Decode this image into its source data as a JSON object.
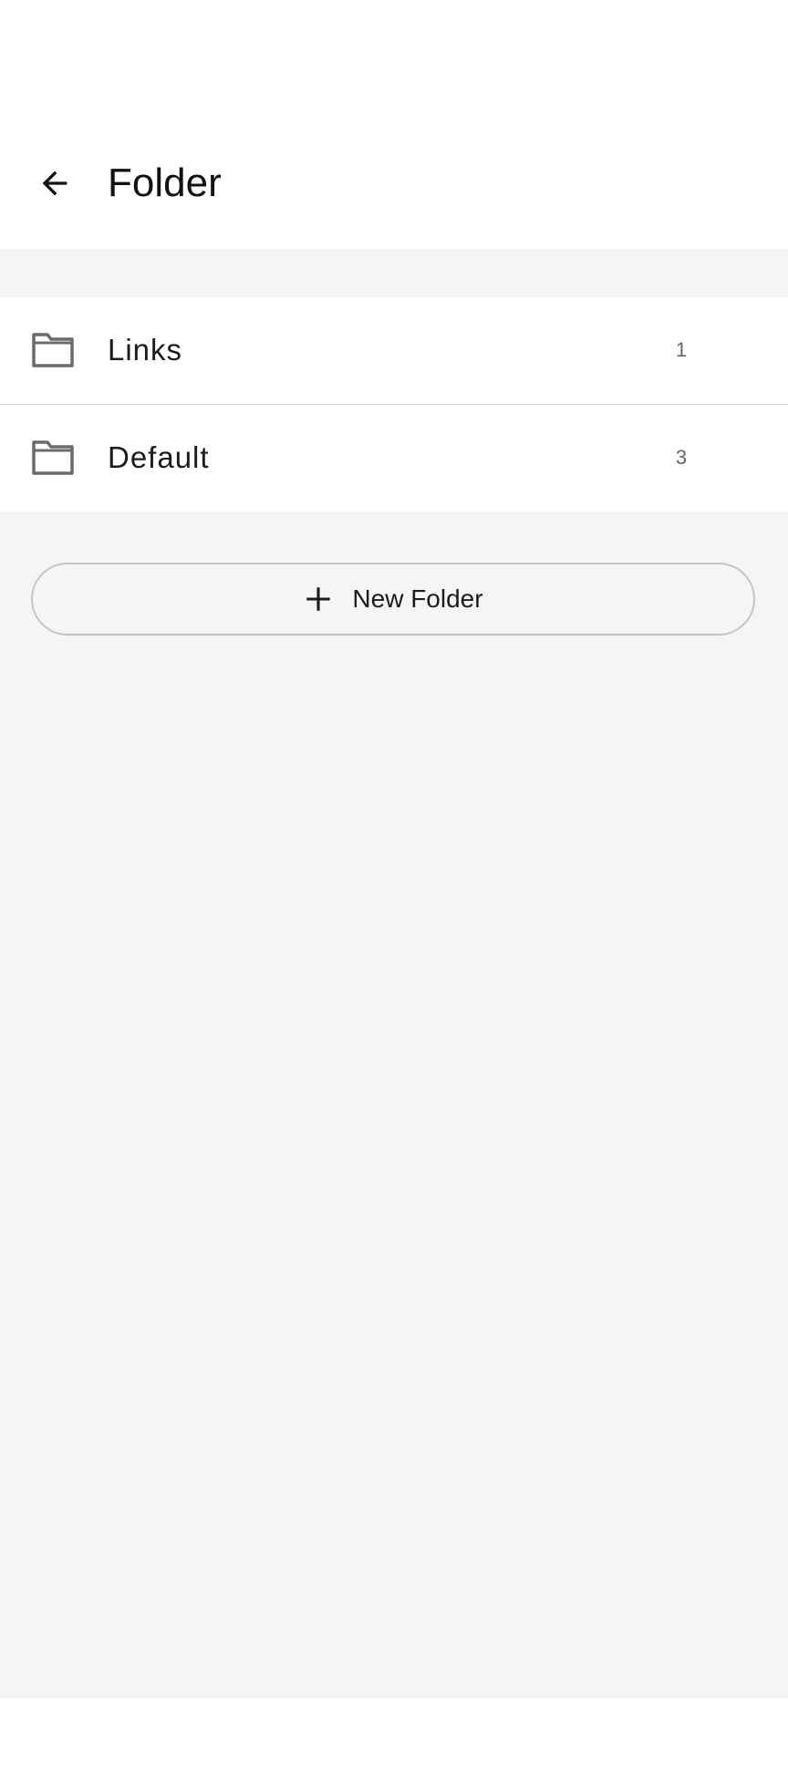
{
  "header": {
    "title": "Folder",
    "back_icon": "arrow-left-icon"
  },
  "folders": [
    {
      "name": "Links",
      "count": "1",
      "icon": "folder-icon"
    },
    {
      "name": "Default",
      "count": "3",
      "icon": "folder-icon"
    }
  ],
  "actions": {
    "new_folder_label": "New Folder",
    "new_folder_icon": "plus-icon"
  },
  "colors": {
    "background": "#f5f5f5",
    "surface": "#ffffff",
    "divider": "#d6d6d6",
    "icon": "#6b6b6b",
    "button_outline": "#c4c4c8"
  }
}
